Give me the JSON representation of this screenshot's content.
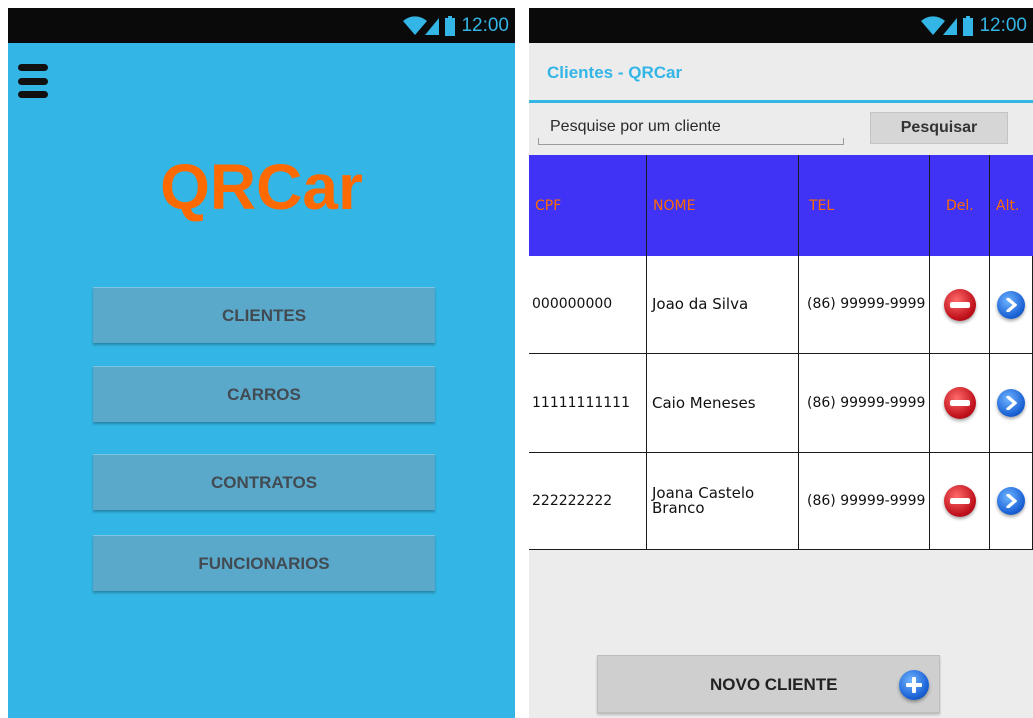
{
  "status_bar": {
    "time": "12:00"
  },
  "home": {
    "logo": "QRCar",
    "menu": [
      "CLIENTES",
      "CARROS",
      "CONTRATOS",
      "FUNCIONARIOS"
    ]
  },
  "clients": {
    "title": "Clientes - QRCar",
    "search": {
      "placeholder": "Pesquise por um cliente",
      "button": "Pesquisar"
    },
    "columns": [
      "CPF",
      "NOME",
      "TEL",
      "Del.",
      "Alt."
    ],
    "rows": [
      {
        "cpf": "000000000",
        "name": "Joao da Silva",
        "tel": "(86) 99999-9999"
      },
      {
        "cpf": "11111111111",
        "name": "Caio Meneses",
        "tel": "(86) 99999-9999"
      },
      {
        "cpf": "222222222",
        "name": "Joana Castelo Branco",
        "tel": "(86) 99999-9999"
      }
    ],
    "new_button": "NOVO CLIENTE"
  },
  "colors": {
    "accent": "#33b5e5",
    "logo": "#ff6a00",
    "table_header": "#4033f5",
    "delete": "#c0111b",
    "edit": "#1b62d6"
  },
  "icons": [
    "wifi-icon",
    "signal-icon",
    "battery-icon",
    "menu-icon",
    "delete-icon",
    "edit-icon",
    "add-icon"
  ]
}
